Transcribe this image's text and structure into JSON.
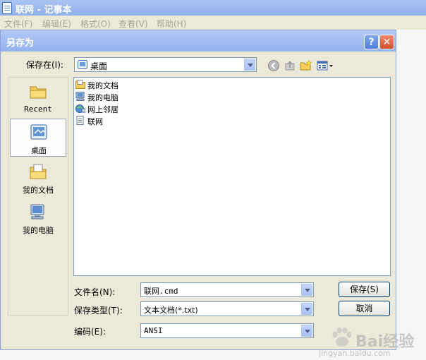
{
  "notepad": {
    "title": "联网 - 记事本",
    "menu": [
      "文件(F)",
      "编辑(E)",
      "格式(O)",
      "查看(V)",
      "帮助(H)"
    ]
  },
  "dialog": {
    "title": "另存为",
    "help_label": "?",
    "close_label": "✕",
    "save_in_label": "保存在(I):",
    "save_in_value": "桌面",
    "places": [
      {
        "label": "Recent",
        "icon": "recent-folder-icon"
      },
      {
        "label": "桌面",
        "icon": "desktop-icon",
        "selected": true
      },
      {
        "label": "我的文档",
        "icon": "my-documents-icon"
      },
      {
        "label": "我的电脑",
        "icon": "my-computer-icon"
      }
    ],
    "files": [
      {
        "name": "我的文档",
        "icon": "my-documents-icon"
      },
      {
        "name": "我的电脑",
        "icon": "my-computer-icon"
      },
      {
        "name": "网上邻居",
        "icon": "network-places-icon"
      },
      {
        "name": "联网",
        "icon": "text-file-icon"
      }
    ],
    "filename_label": "文件名(N):",
    "filename_value": "联网.cmd",
    "filetype_label": "保存类型(T):",
    "filetype_value": "文本文档(*.txt)",
    "encoding_label": "编码(E):",
    "encoding_value": "ANSI",
    "save_button": "保存(S)",
    "cancel_button": "取消"
  },
  "watermark": {
    "logo_text": "Bai经验",
    "url": "jingyan.baidu.com"
  }
}
